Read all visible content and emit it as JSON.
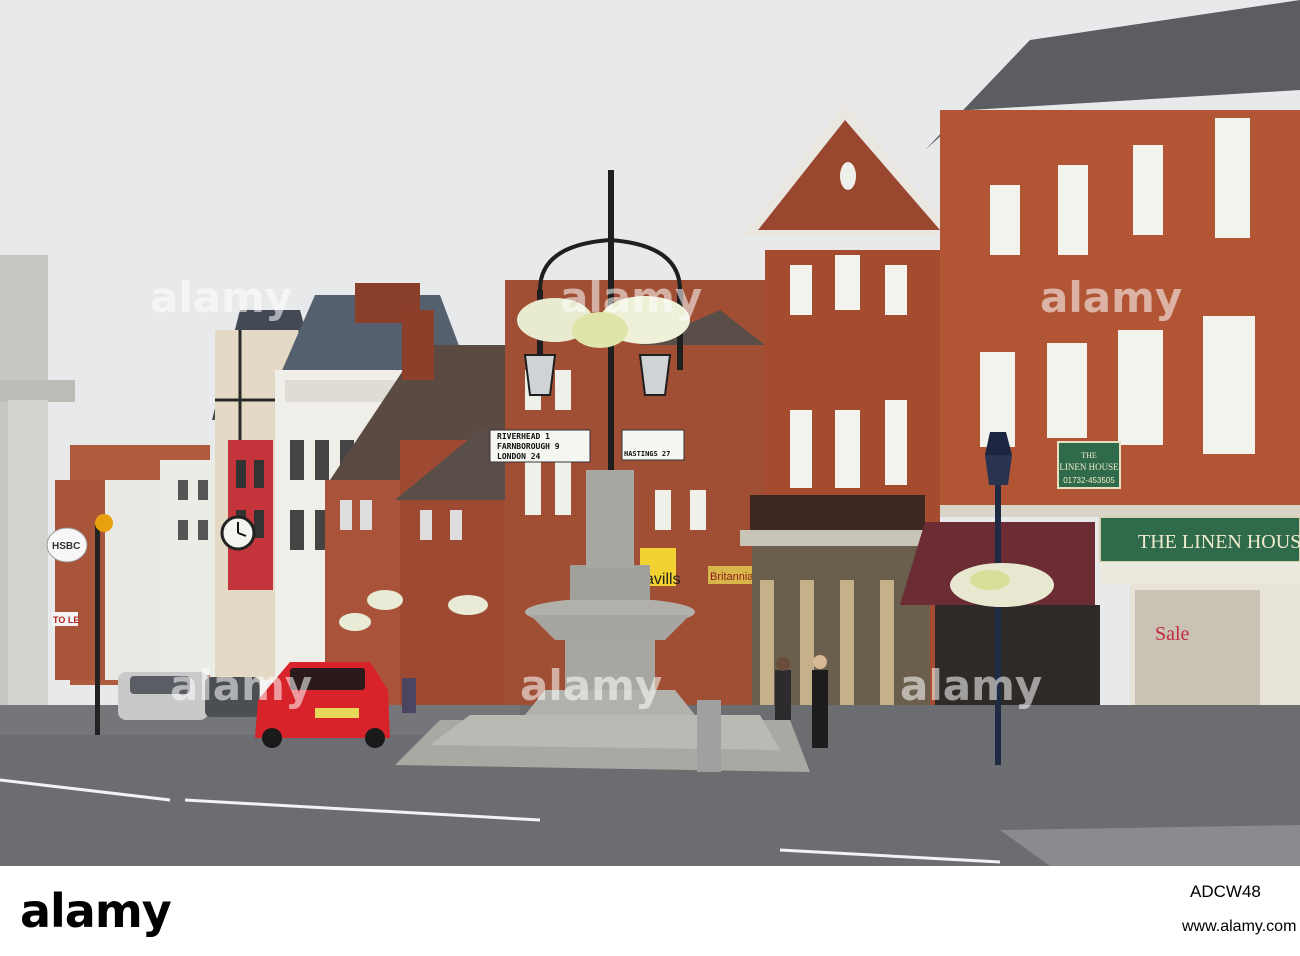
{
  "signpost": {
    "left_arm": [
      "RIVERHEAD 1",
      "FARNBOROUGH 9",
      "LONDON 24"
    ],
    "right_arm": [
      "",
      "",
      "HASTINGS 27"
    ]
  },
  "shops": {
    "hsbc": "HSBC",
    "to_let": "TO LE",
    "savills": "avills",
    "britannia": "Britannia",
    "linen_house_fascia": "THE LINEN HOUSE",
    "linen_house_board_line1": "THE",
    "linen_house_board_line2": "LINEN HOUSE",
    "linen_house_board_phone": "01732-453505",
    "sale": "Sale"
  },
  "watermark": "alamy",
  "footer": {
    "logo": "alamy",
    "image_id": "ADCW48",
    "url": "www.alamy.com"
  },
  "colors": {
    "sky": "#e9eaec",
    "brick": "#9a4a32",
    "road": "#6a6b6d",
    "car": "#d8232a",
    "linen_green": "#2f6a4a"
  }
}
